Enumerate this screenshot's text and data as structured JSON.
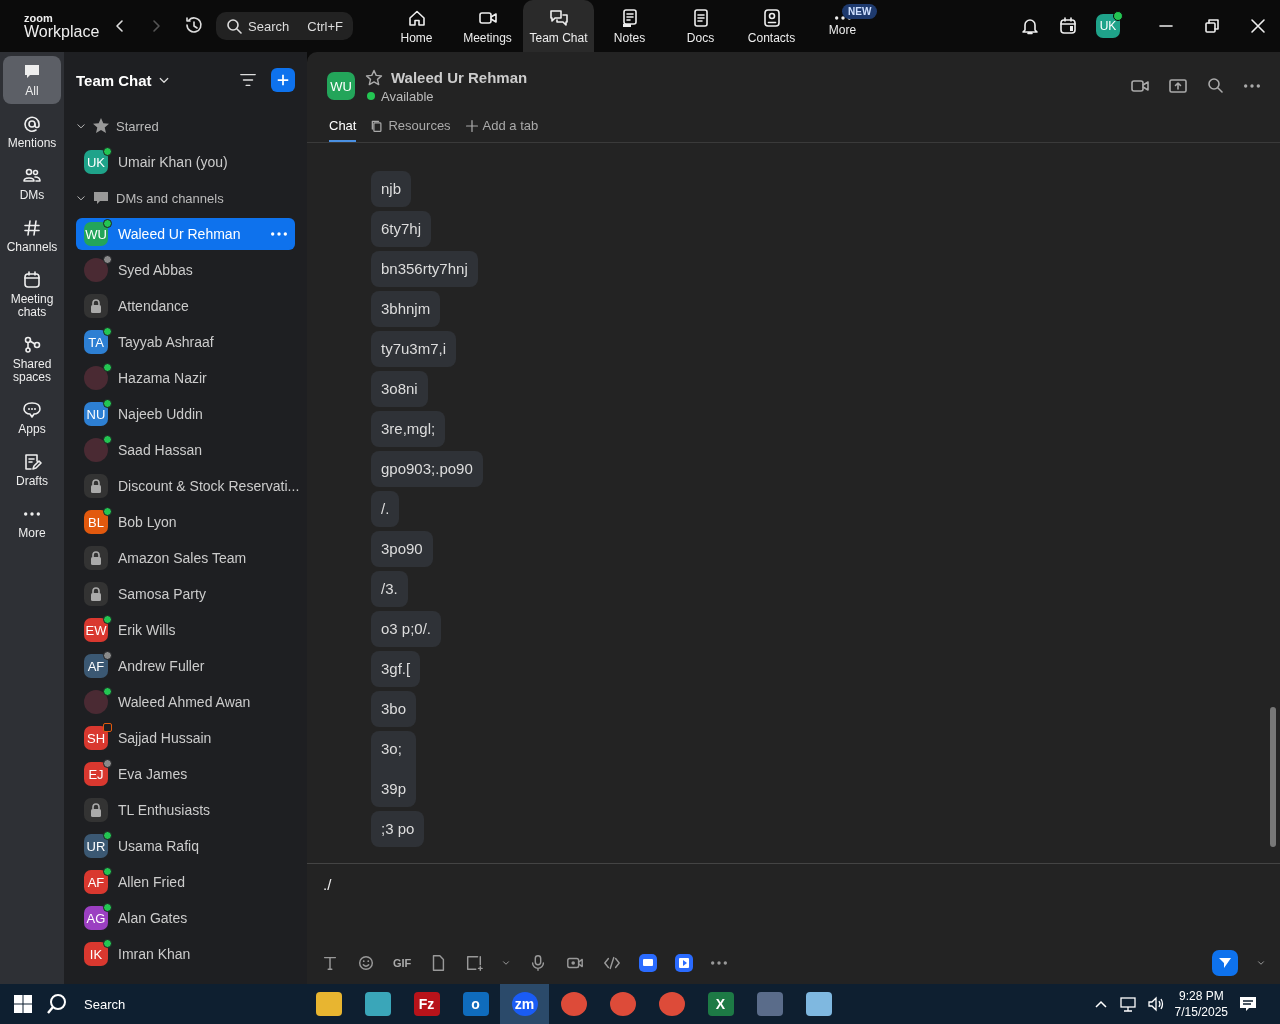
{
  "app": {
    "logo_top": "zoom",
    "logo_bottom": "Workplace"
  },
  "search": {
    "placeholder": "Search",
    "shortcut": "Ctrl+F"
  },
  "nav": [
    {
      "label": "Home",
      "selected": false
    },
    {
      "label": "Meetings",
      "selected": false
    },
    {
      "label": "Team Chat",
      "selected": true
    },
    {
      "label": "Notes",
      "selected": false
    },
    {
      "label": "Docs",
      "selected": false
    },
    {
      "label": "Contacts",
      "selected": false
    },
    {
      "label": "More",
      "selected": false,
      "badge": "NEW"
    }
  ],
  "account": {
    "initials": "UK",
    "status": {
      "kind": "dot",
      "color": "#23c552"
    }
  },
  "rail": [
    {
      "label": "All",
      "selected": true
    },
    {
      "label": "Mentions",
      "selected": false
    },
    {
      "label": "DMs",
      "selected": false
    },
    {
      "label": "Channels",
      "selected": false
    },
    {
      "label": "Meeting chats",
      "selected": false
    },
    {
      "label": "Shared spaces",
      "selected": false
    },
    {
      "label": "Apps",
      "selected": false
    },
    {
      "label": "Drafts",
      "selected": false
    },
    {
      "label": "More",
      "selected": false
    }
  ],
  "sidebar": {
    "title": "Team Chat",
    "sections": [
      {
        "label": "Starred",
        "expanded": true,
        "items": [
          {
            "name": "Umair Khan (you)",
            "kind": "initials",
            "initials": "UK",
            "color": "#1fa38a",
            "status": {
              "kind": "dot",
              "color": "#23c552"
            },
            "selected": false
          }
        ]
      },
      {
        "label": "DMs and channels",
        "expanded": true,
        "items": [
          {
            "name": "Waleed Ur Rehman",
            "kind": "initials",
            "initials": "WU",
            "color": "#23a55a",
            "status": {
              "kind": "dot",
              "color": "#23c552"
            },
            "selected": true
          },
          {
            "name": "Syed Abbas",
            "kind": "photo",
            "status": {
              "kind": "dot",
              "color": "#8a8a8a"
            },
            "selected": false
          },
          {
            "name": "Attendance",
            "kind": "lock",
            "selected": false
          },
          {
            "name": "Tayyab Ashraaf",
            "kind": "initials",
            "initials": "TA",
            "color": "#2d7fd3",
            "status": {
              "kind": "dot",
              "color": "#23c552"
            },
            "selected": false
          },
          {
            "name": "Hazama Nazir",
            "kind": "photo",
            "status": {
              "kind": "dot",
              "color": "#23c552"
            },
            "selected": false
          },
          {
            "name": "Najeeb Uddin",
            "kind": "initials",
            "initials": "NU",
            "color": "#2d7fd3",
            "status": {
              "kind": "dot",
              "color": "#23c552"
            },
            "selected": false
          },
          {
            "name": "Saad Hassan",
            "kind": "photo",
            "status": {
              "kind": "dot",
              "color": "#23c552"
            },
            "selected": false
          },
          {
            "name": "Discount & Stock Reservati...",
            "kind": "lock",
            "selected": false
          },
          {
            "name": "Bob Lyon",
            "kind": "initials",
            "initials": "BL",
            "color": "#e2590e",
            "status": {
              "kind": "dot",
              "color": "#23c552"
            },
            "selected": false
          },
          {
            "name": "Amazon Sales Team",
            "kind": "lock",
            "selected": false
          },
          {
            "name": "Samosa Party",
            "kind": "lock",
            "selected": false
          },
          {
            "name": "Erik Wills",
            "kind": "initials",
            "initials": "EW",
            "color": "#d9382f",
            "status": {
              "kind": "dot",
              "color": "#23c552"
            },
            "selected": false
          },
          {
            "name": "Andrew Fuller",
            "kind": "initials",
            "initials": "AF",
            "color": "#3b5873",
            "status": {
              "kind": "dot",
              "color": "#8a8a8a"
            },
            "selected": false
          },
          {
            "name": "Waleed Ahmed Awan",
            "kind": "photo",
            "status": {
              "kind": "dot",
              "color": "#23c552"
            },
            "selected": false
          },
          {
            "name": "Sajjad Hussain",
            "kind": "initials",
            "initials": "SH",
            "color": "#d9382f",
            "status": {
              "kind": "box",
              "color": "#e2590e"
            },
            "selected": false
          },
          {
            "name": "Eva James",
            "kind": "initials",
            "initials": "EJ",
            "color": "#d9382f",
            "status": {
              "kind": "dot",
              "color": "#8a8a8a"
            },
            "selected": false
          },
          {
            "name": "TL Enthusiasts",
            "kind": "lock",
            "selected": false
          },
          {
            "name": "Usama Rafiq",
            "kind": "initials",
            "initials": "UR",
            "color": "#3b5873",
            "status": {
              "kind": "dot",
              "color": "#23c552"
            },
            "selected": false
          },
          {
            "name": "Allen Fried",
            "kind": "initials",
            "initials": "AF",
            "color": "#d9382f",
            "status": {
              "kind": "dot",
              "color": "#23c552"
            },
            "selected": false
          },
          {
            "name": "Alan Gates",
            "kind": "initials",
            "initials": "AG",
            "color": "#9b3fc1",
            "status": {
              "kind": "dot",
              "color": "#23c552"
            },
            "selected": false
          },
          {
            "name": "Imran Khan",
            "kind": "initials",
            "initials": "IK",
            "color": "#d9382f",
            "status": {
              "kind": "dot",
              "color": "#23c552"
            },
            "selected": false
          }
        ]
      }
    ]
  },
  "chat": {
    "initials": "WU",
    "color": "#23a55a",
    "name": "Waleed Ur Rehman",
    "presence": "Available",
    "starred": false,
    "tabs": [
      {
        "label": "Chat",
        "selected": true
      },
      {
        "label": "Resources",
        "selected": false
      },
      {
        "label": "Add a tab",
        "selected": false
      }
    ],
    "messages": [
      "njb",
      "6ty7hj",
      "bn356rty7hnj",
      "3bhnjm",
      "ty7u3m7,i",
      "3o8ni",
      "3re,mgl;",
      "gpo903;.po90",
      "/.",
      "3po90",
      "/3.",
      "o3 p;0/.",
      "3gf.[",
      "3bo",
      "3o;\n\n39p",
      ";3 po"
    ],
    "composer": {
      "value": "./",
      "gif": "GIF"
    }
  },
  "taskbar": {
    "search": "Search",
    "apps": [
      {
        "kind": "folder",
        "selected": false
      },
      {
        "kind": "gem",
        "selected": false
      },
      {
        "kind": "filezilla",
        "label": "Fz",
        "selected": false
      },
      {
        "kind": "outlook",
        "label": "o",
        "selected": false
      },
      {
        "kind": "zoom",
        "label": "zm",
        "selected": true
      },
      {
        "kind": "chrome",
        "selected": false
      },
      {
        "kind": "chrome",
        "selected": false
      },
      {
        "kind": "chrome",
        "selected": false
      },
      {
        "kind": "excel",
        "label": "X",
        "selected": false
      },
      {
        "kind": "calculator",
        "selected": false
      },
      {
        "kind": "notepad",
        "selected": false
      }
    ],
    "time": "9:28 PM",
    "date": "7/15/2025"
  }
}
